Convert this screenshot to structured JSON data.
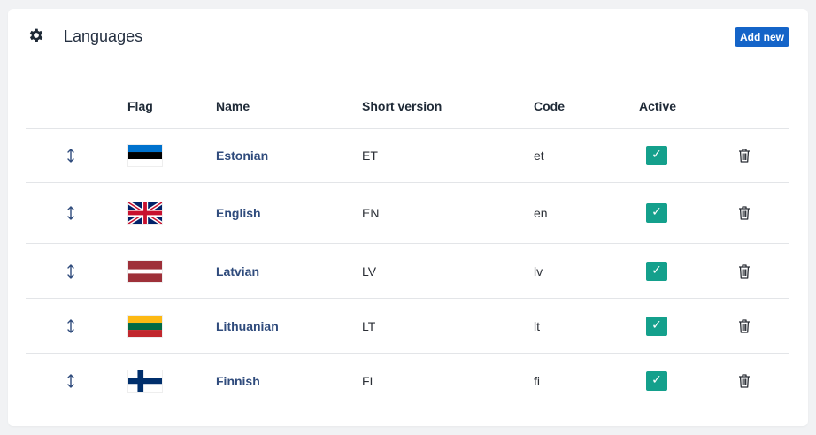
{
  "header": {
    "title": "Languages",
    "add_label": "Add new",
    "icon": "gear-icon"
  },
  "columns": [
    "Flag",
    "Name",
    "Short version",
    "Code",
    "Active"
  ],
  "languages": [
    {
      "name": "Estonian",
      "short": "ET",
      "code": "et",
      "active": true,
      "flag": "estonia"
    },
    {
      "name": "English",
      "short": "EN",
      "code": "en",
      "active": true,
      "flag": "united-kingdom"
    },
    {
      "name": "Latvian",
      "short": "LV",
      "code": "lv",
      "active": true,
      "flag": "latvia"
    },
    {
      "name": "Lithuanian",
      "short": "LT",
      "code": "lt",
      "active": true,
      "flag": "lithuania"
    },
    {
      "name": "Finnish",
      "short": "FI",
      "code": "fi",
      "active": true,
      "flag": "finland"
    }
  ],
  "icons": {
    "reorder": "sort-handle-icon",
    "active": "checkmark-icon",
    "delete": "trash-icon"
  },
  "colors": {
    "accent": "#1464c8",
    "active": "#14a08c",
    "name_link": "#2f4b7c"
  }
}
